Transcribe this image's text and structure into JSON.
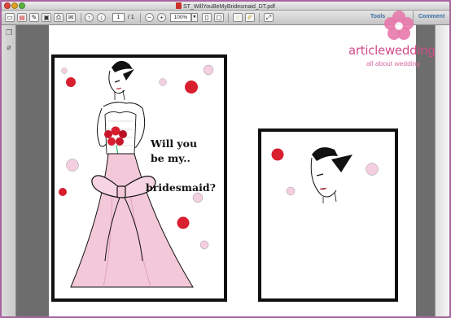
{
  "window": {
    "title": "ST_WillYouBeMyBridesmaid_DT.pdf"
  },
  "toolbar": {
    "page_current": "1",
    "page_total": "/ 1",
    "zoom": "100%",
    "tools_label": "Tools",
    "comment_label": "Comment"
  },
  "watermark": {
    "brand": "articlewedding",
    "tagline": "all about wedding"
  },
  "document": {
    "card1": {
      "line1": "Will you",
      "line2": "be my..",
      "line3": "bridesmaid?"
    }
  },
  "colors": {
    "accent_pink": "#d24d8a",
    "dot_red": "#d81e2f",
    "dot_pink": "#f3cfe0",
    "dress_pink": "#f3c8d8"
  }
}
